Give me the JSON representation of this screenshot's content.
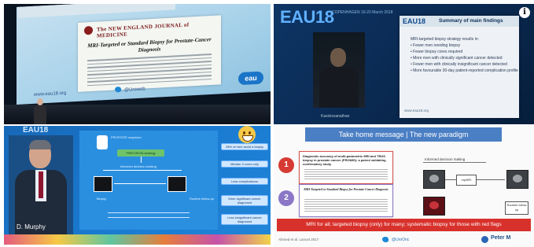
{
  "panel1": {
    "journal": "The NEW ENGLAND JOURNAL of MEDICINE",
    "article_title": "MRI-Targeted or Standard Biopsy for Prostate-Cancer Diagnosis",
    "url": "www.eau18.org",
    "handle": "@Uroweb",
    "logo": "eau"
  },
  "panel2": {
    "event_logo": "EAU",
    "event_year": "18",
    "event_city": "COPENHAGEN 16-20 March 2018",
    "slide_logo": "EAU18",
    "slide_title": "Summary of main findings",
    "findings": [
      "MRI-targeted biopsy strategy results in:",
      "• Fewer men needing biopsy",
      "• Fewer biopsy cores required",
      "• More men with clinically significant cancer detected",
      "• Fewer men with clinically insignificant cancer detected",
      "• More favourable 30-day patient-reported complication profile"
    ],
    "slide_url": "www.eau18.org",
    "speaker_caption": "Kasivisvanathan",
    "info_icon": "info-icon"
  },
  "panel3": {
    "event_logo": "EAU18",
    "speaker_name": "D. Murphy",
    "flow_top": "PROSTATE suspicion",
    "flow_main": "PRECISION strategy",
    "flow_decision": "Informed decision-making",
    "flow_bottom_left": "Biopsy",
    "flow_bottom_right": "Routine follow-up",
    "benefits": [
      "28% of men avoid a biopsy",
      "Median 3 cores only",
      "Less complications",
      "More significant cancer diagnosed",
      "Less insignificant cancer diagnosed"
    ],
    "smiley_icon": "smiley-icon"
  },
  "panel4": {
    "header": "Take home message | The new paradigm",
    "item1_num": "1",
    "item1_title": "Diagnostic accuracy of multi-parametric MRI and TRUS biopsy in prostate cancer (PROMIS): a paired validating confirmatory study",
    "item2_num": "2",
    "item2_title": "MRI-Targeted or Standard Biopsy for Prostate-Cancer Diagnosis",
    "decision_label": "Informed decision making",
    "mpmri_label": "mpMRI",
    "routine_label": "Routine follow up",
    "banner": "MRI for all; targeted biopsy (only) for many; systematic biopsy for those with red flags",
    "citation": "Ahmed et al. Lancet 2017",
    "handle": "@UroOnc",
    "brand": "Peter M"
  }
}
